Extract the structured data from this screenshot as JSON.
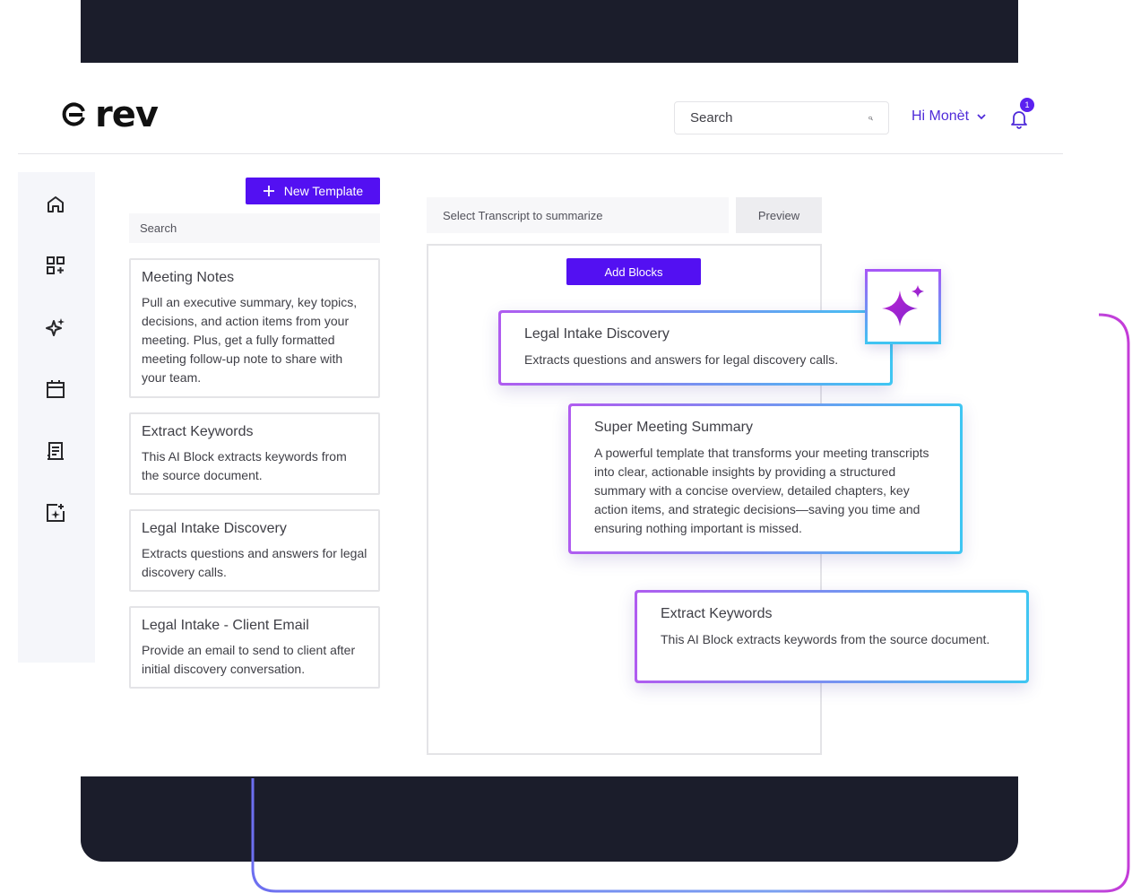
{
  "brand": {
    "name": "rev"
  },
  "header": {
    "search_placeholder": "Search",
    "greeting": "Hi Monèt",
    "notification_count": "1"
  },
  "templates": {
    "new_button": "New Template",
    "search_placeholder": "Search",
    "items": [
      {
        "title": "Meeting Notes",
        "description": "Pull an executive summary, key topics, decisions, and action items from your meeting. Plus, get a fully formatted meeting follow-up note to share with your team."
      },
      {
        "title": "Extract Keywords",
        "description": "This AI Block extracts keywords from the source document."
      },
      {
        "title": "Legal Intake Discovery",
        "description": "Extracts questions and answers for legal discovery calls."
      },
      {
        "title": "Legal Intake - Client Email",
        "description": "Provide an email to send to client after initial discovery conversation."
      }
    ]
  },
  "builder": {
    "transcript_placeholder": "Select Transcript to summarize",
    "preview_label": "Preview",
    "add_blocks_label": "Add Blocks",
    "blocks": [
      {
        "title": "Legal Intake Discovery",
        "description": "Extracts questions and answers for legal discovery calls."
      },
      {
        "title": "Super Meeting Summary",
        "description": "A powerful template that transforms your meeting transcripts into clear, actionable insights by providing a structured summary with a concise overview, detailed chapters, key action items, and strategic decisions—saving you time and ensuring nothing important is missed."
      },
      {
        "title": "Extract Keywords",
        "description": "This AI Block extracts keywords from the source document."
      }
    ]
  },
  "sidebar": {
    "icons": [
      "home-icon",
      "add-app-icon",
      "ai-sparkle-icon",
      "calendar-icon",
      "transcript-icon",
      "ai-image-icon"
    ]
  },
  "colors": {
    "accent": "#5310f2",
    "greeting": "#4f2bd9",
    "dark_band": "#1b1d2b",
    "gradient_start": "#b05cf0",
    "gradient_end": "#3fc6f2"
  }
}
